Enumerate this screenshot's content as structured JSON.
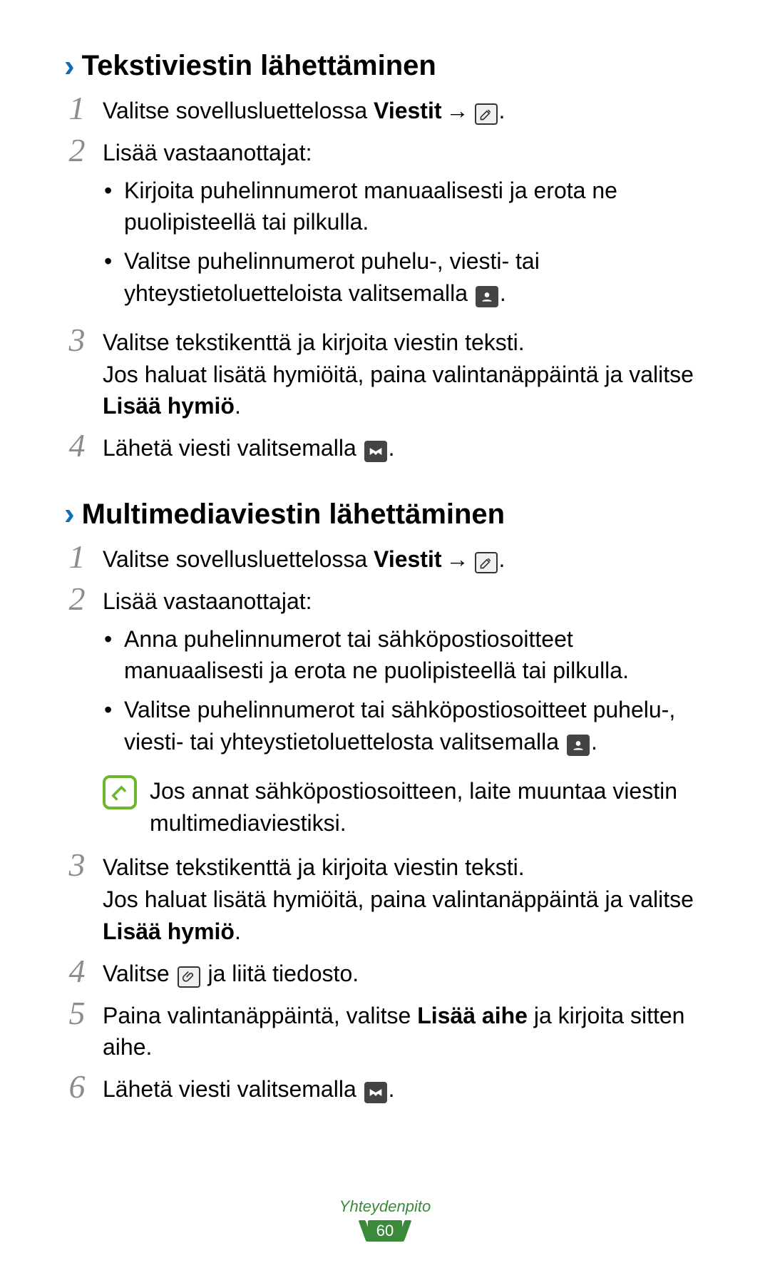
{
  "section1": {
    "title": "Tekstiviestin lähettäminen",
    "step1_a": "Valitse sovellusluettelossa ",
    "step1_b": "Viestit",
    "step1_c": " → ",
    "step1_d": ".",
    "step2_intro": "Lisää vastaanottajat:",
    "step2_b1": "Kirjoita puhelinnumerot manuaalisesti ja erota ne puolipisteellä tai pilkulla.",
    "step2_b2a": "Valitse puhelinnumerot puhelu-, viesti- tai yhteystietoluetteloista valitsemalla ",
    "step2_b2b": ".",
    "step3_a": "Valitse tekstikenttä ja kirjoita viestin teksti.",
    "step3_b": "Jos haluat lisätä hymiöitä, paina valintanäppäintä ja valitse ",
    "step3_c": "Lisää hymiö",
    "step3_d": ".",
    "step4_a": "Lähetä viesti valitsemalla ",
    "step4_b": "."
  },
  "section2": {
    "title": "Multimediaviestin lähettäminen",
    "step1_a": "Valitse sovellusluettelossa ",
    "step1_b": "Viestit",
    "step1_c": " → ",
    "step1_d": ".",
    "step2_intro": "Lisää vastaanottajat:",
    "step2_b1": "Anna puhelinnumerot tai sähköpostiosoitteet manuaalisesti ja erota ne puolipisteellä tai pilkulla.",
    "step2_b2a": "Valitse puhelinnumerot tai sähköpostiosoitteet puhelu-, viesti- tai yhteystietoluettelosta valitsemalla ",
    "step2_b2b": ".",
    "note": "Jos annat sähköpostiosoitteen, laite muuntaa viestin multimediaviestiksi.",
    "step3_a": "Valitse tekstikenttä ja kirjoita viestin teksti.",
    "step3_b": "Jos haluat lisätä hymiöitä, paina valintanäppäintä ja valitse ",
    "step3_c": "Lisää hymiö",
    "step3_d": ".",
    "step4_a": "Valitse ",
    "step4_b": " ja liitä tiedosto.",
    "step5_a": "Paina valintanäppäintä, valitse ",
    "step5_b": "Lisää aihe",
    "step5_c": " ja kirjoita sitten aihe.",
    "step6_a": "Lähetä viesti valitsemalla ",
    "step6_b": "."
  },
  "footer": {
    "category": "Yhteydenpito",
    "page": "60"
  },
  "nums": {
    "n1": "1",
    "n2": "2",
    "n3": "3",
    "n4": "4",
    "n5": "5",
    "n6": "6"
  }
}
